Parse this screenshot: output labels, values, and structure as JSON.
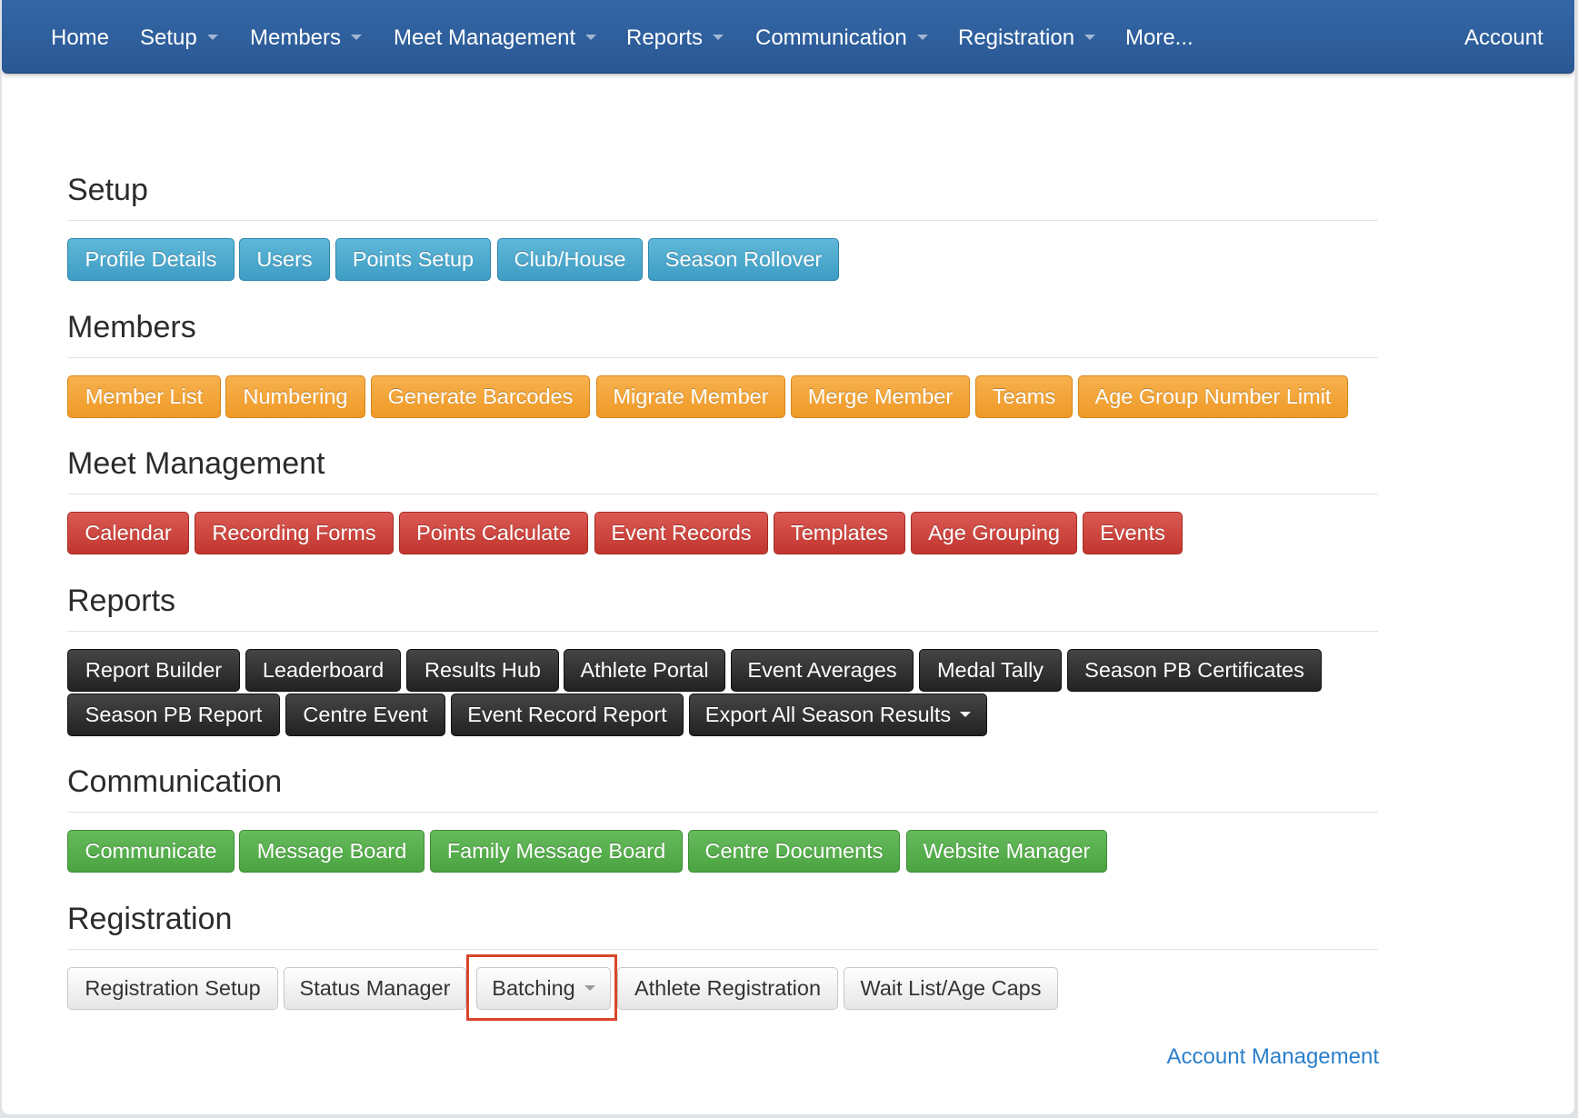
{
  "nav": {
    "home": "Home",
    "setup": "Setup",
    "members": "Members",
    "meet_management": "Meet Management",
    "reports": "Reports",
    "communication": "Communication",
    "registration": "Registration",
    "more": "More...",
    "account": "Account"
  },
  "sections": {
    "setup": {
      "title": "Setup",
      "buttons": [
        "Profile Details",
        "Users",
        "Points Setup",
        "Club/House",
        "Season Rollover"
      ]
    },
    "members": {
      "title": "Members",
      "buttons": [
        "Member List",
        "Numbering",
        "Generate Barcodes",
        "Migrate Member",
        "Merge Member",
        "Teams",
        "Age Group Number Limit"
      ]
    },
    "meet_management": {
      "title": "Meet Management",
      "buttons": [
        "Calendar",
        "Recording Forms",
        "Points Calculate",
        "Event Records",
        "Templates",
        "Age Grouping",
        "Events"
      ]
    },
    "reports": {
      "title": "Reports",
      "buttons": [
        "Report Builder",
        "Leaderboard",
        "Results Hub",
        "Athlete Portal",
        "Event Averages",
        "Medal Tally",
        "Season PB Certificates",
        "Season PB Report",
        "Centre Event",
        "Event Record Report",
        "Export All Season Results"
      ]
    },
    "communication": {
      "title": "Communication",
      "buttons": [
        "Communicate",
        "Message Board",
        "Family Message Board",
        "Centre Documents",
        "Website Manager"
      ]
    },
    "registration": {
      "title": "Registration",
      "buttons": [
        "Registration Setup",
        "Status Manager",
        "Batching",
        "Athlete Registration",
        "Wait List/Age Caps"
      ]
    }
  },
  "footer": {
    "account_management": "Account Management"
  },
  "colors": {
    "navbar": "#2a5894",
    "setup": "#4aa6cc",
    "members": "#f0a030",
    "meet_management": "#cc4540",
    "reports": "#2e2e2e",
    "communication": "#55ab4a",
    "registration": "#f0f0f0",
    "highlight": "#d9452b",
    "link": "#2b7fcb"
  }
}
